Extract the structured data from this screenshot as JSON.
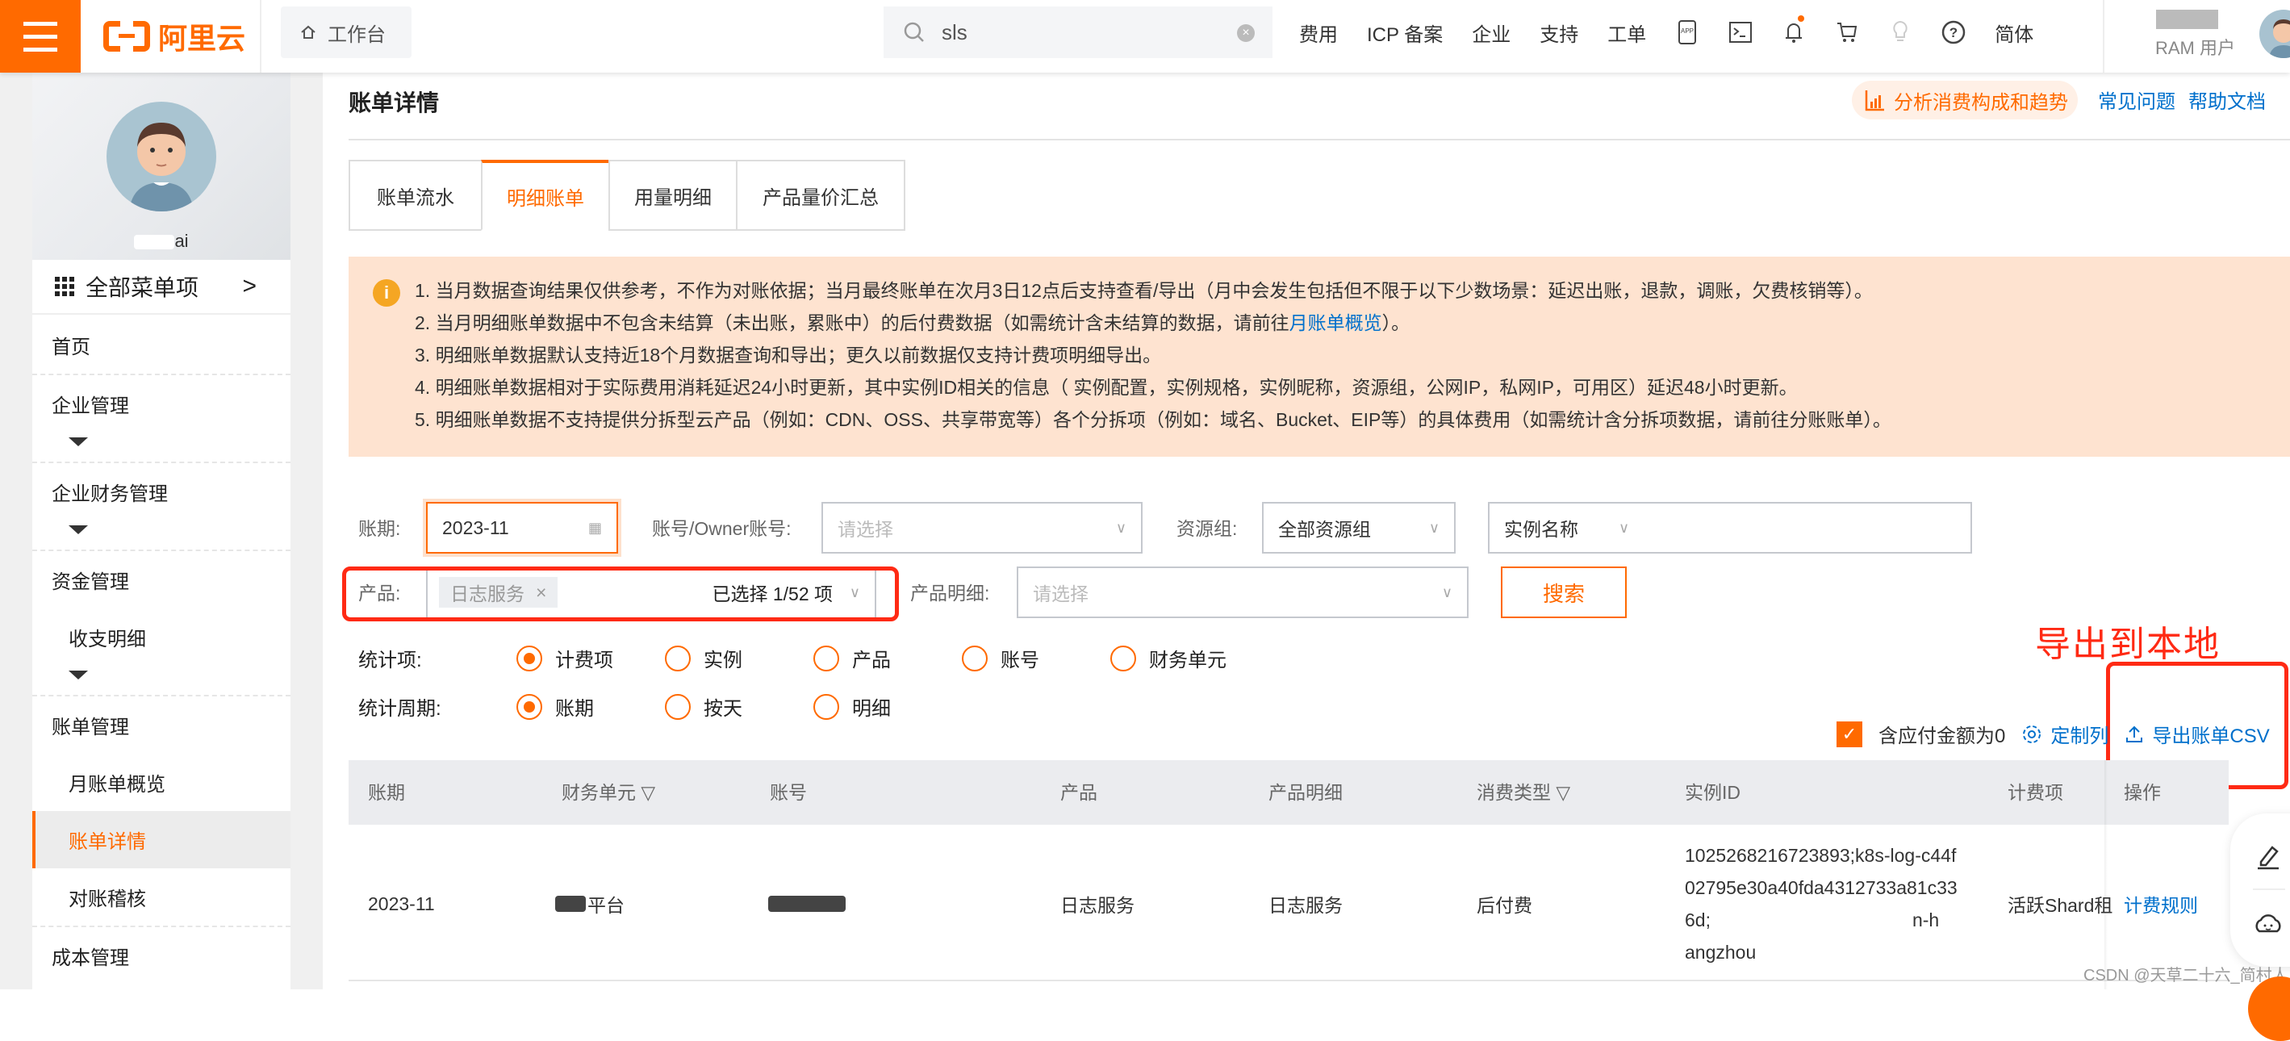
{
  "topbar": {
    "logo_text": "阿里云",
    "workbench_label": "工作台",
    "search_value": "sls",
    "nav_items": [
      "费用",
      "ICP 备案",
      "企业",
      "支持",
      "工单"
    ],
    "nav_icons": [
      "app-icon",
      "terminal-icon",
      "bell-icon",
      "cart-icon",
      "lightbulb-icon",
      "help-icon"
    ],
    "language": "简体",
    "user_role": "RAM 用户"
  },
  "sidebar": {
    "profile_name_suffix": "ai",
    "all_menu_label": "全部菜单项",
    "items": [
      {
        "label": "首页",
        "level": 1
      },
      {
        "label": "企业管理",
        "level": 1
      },
      {
        "label": "企业财务管理",
        "level": 1
      },
      {
        "label": "资金管理",
        "level": 1
      },
      {
        "label": "收支明细",
        "level": 2
      },
      {
        "label": "账单管理",
        "level": 1
      },
      {
        "label": "月账单概览",
        "level": 2
      },
      {
        "label": "账单详情",
        "level": 2,
        "active": true
      },
      {
        "label": "对账稽核",
        "level": 2
      },
      {
        "label": "成本管理",
        "level": 1
      }
    ]
  },
  "page": {
    "title": "账单详情",
    "analysis_button": "分析消费构成和趋势",
    "links": [
      "常见问题",
      "帮助文档"
    ],
    "tabs": [
      {
        "label": "账单流水",
        "active": false
      },
      {
        "label": "明细账单",
        "active": true
      },
      {
        "label": "用量明细",
        "active": false
      },
      {
        "label": "产品量价汇总",
        "active": false
      }
    ]
  },
  "notice": {
    "lines": [
      "1. 当月数据查询结果仅供参考，不作为对账依据；当月最终账单在次月3日12点后支持查看/导出（月中会发生包括但不限于以下少数场景：延迟出账，退款，调账，欠费核销等）。",
      "2. 当月明细账单数据中不包含未结算（未出账，累账中）的后付费数据（如需统计含未结算的数据，请前往",
      "3. 明细账单数据默认支持近18个月数据查询和导出；更久以前数据仅支持计费项明细导出。",
      "4. 明细账单数据相对于实际费用消耗延迟24小时更新，其中实例ID相关的信息（ 实例配置，实例规格，实例昵称，资源组，公网IP，私网IP，可用区）延迟48小时更新。",
      "5. 明细账单数据不支持提供分拆型云产品（例如：CDN、OSS、共享带宽等）各个分拆项（例如：域名、Bucket、EIP等）的具体费用（如需统计含分拆项数据，请前往分账账单）。"
    ],
    "line2_link": "月账单概览",
    "line2_tail": "）。"
  },
  "filters": {
    "period_label": "账期:",
    "period_value": "2023-11",
    "account_label": "账号/Owner账号:",
    "account_placeholder": "请选择",
    "resource_group_label": "资源组:",
    "resource_group_value": "全部资源组",
    "instance_name_value": "实例名称",
    "product_label": "产品:",
    "product_tag": "日志服务",
    "product_selected": "已选择 1/52 项",
    "product_detail_label": "产品明细:",
    "product_detail_placeholder": "请选择",
    "search_button": "搜索",
    "stat_item_label": "统计项:",
    "stat_items": [
      {
        "label": "计费项",
        "checked": true
      },
      {
        "label": "实例",
        "checked": false
      },
      {
        "label": "产品",
        "checked": false
      },
      {
        "label": "账号",
        "checked": false
      },
      {
        "label": "财务单元",
        "checked": false
      }
    ],
    "stat_period_label": "统计周期:",
    "stat_periods": [
      {
        "label": "账期",
        "checked": true
      },
      {
        "label": "按天",
        "checked": false
      },
      {
        "label": "明细",
        "checked": false
      }
    ]
  },
  "toolbar": {
    "include_zero_label": "含应付金额为0",
    "include_zero_checked": true,
    "customize_columns": "定制列",
    "export_csv": "导出账单CSV"
  },
  "annotation": {
    "text": "导出到本地"
  },
  "table": {
    "columns": [
      "账期",
      "财务单元",
      "账号",
      "产品",
      "产品明细",
      "消费类型",
      "实例ID",
      "计费项",
      "操作"
    ],
    "rows": [
      {
        "period": "2023-11",
        "finance_unit_suffix": "平台",
        "account": "",
        "product": "日志服务",
        "product_detail": "日志服务",
        "consume_type": "后付费",
        "instance_id_lines": [
          "1025268216723893;k8s-log-c44f",
          "02795e30a40fda4312733a81c33",
          "6d;",
          "angzhou"
        ],
        "billing_item": "活跃Shard租",
        "action": "计费规则"
      }
    ]
  },
  "watermark": "CSDN @天草二十六_简村人"
}
